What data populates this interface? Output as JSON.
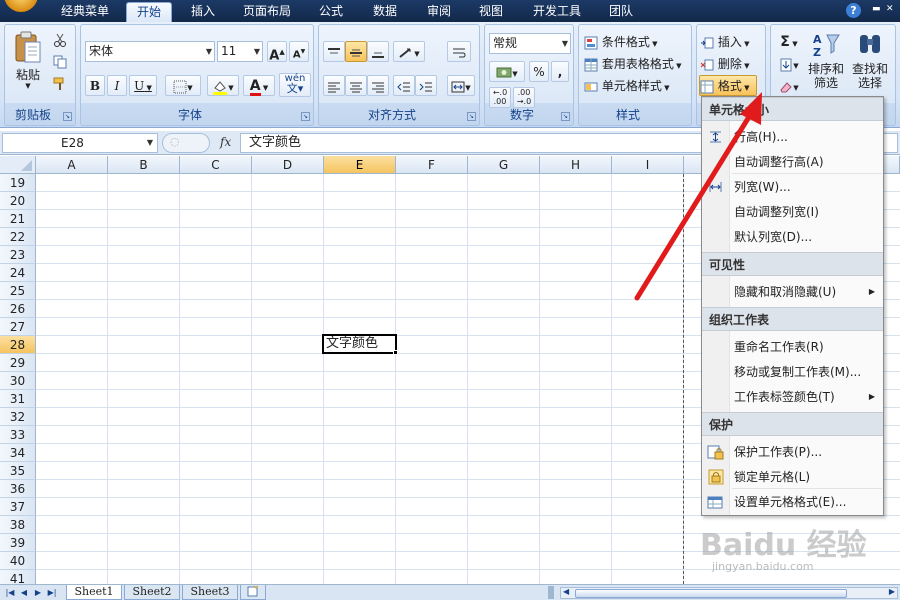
{
  "tabs": [
    {
      "label": "经典菜单"
    },
    {
      "label": "开始"
    },
    {
      "label": "插入"
    },
    {
      "label": "页面布局"
    },
    {
      "label": "公式"
    },
    {
      "label": "数据"
    },
    {
      "label": "审阅"
    },
    {
      "label": "视图"
    },
    {
      "label": "开发工具"
    },
    {
      "label": "团队"
    }
  ],
  "active_tab": "开始",
  "clipboard": {
    "group_label": "剪贴板",
    "paste_label": "粘贴"
  },
  "font": {
    "group_label": "字体",
    "font_name": "宋体",
    "font_size": "11",
    "bold": "B",
    "italic": "I",
    "underline": "U",
    "grow": "A",
    "shrink": "A",
    "font_color_letter": "A",
    "pinyin": "wén"
  },
  "alignment": {
    "group_label": "对齐方式"
  },
  "number": {
    "group_label": "数字",
    "format": "常规",
    "percent": "%",
    "comma": ",",
    "inc_decimal": "+.0\n.00",
    "dec_decimal": ".00\n+.0"
  },
  "styles": {
    "group_label": "样式",
    "conditional_format": "条件格式",
    "table_format": "套用表格格式",
    "cell_styles": "单元格样式"
  },
  "cells": {
    "insert": "插入",
    "delete": "删除",
    "format": "格式"
  },
  "editing": {
    "sigma": "Σ",
    "sort_filter_1": "排序和",
    "sort_filter_2": "筛选",
    "find_select_1": "查找和",
    "find_select_2": "选择"
  },
  "formula_bar": {
    "name_box": "E28",
    "fx": "fx",
    "content": "文字颜色"
  },
  "columns": [
    "A",
    "B",
    "C",
    "D",
    "E",
    "F",
    "G",
    "H",
    "I"
  ],
  "selected_column": "E",
  "rows": [
    "19",
    "20",
    "21",
    "22",
    "23",
    "24",
    "25",
    "26",
    "27",
    "28",
    "29",
    "30",
    "31",
    "32",
    "33",
    "34",
    "35",
    "36",
    "37",
    "38",
    "39",
    "40",
    "41"
  ],
  "selected_row": "28",
  "active_cell": {
    "ref": "E28",
    "value": "文字颜色"
  },
  "sheets": [
    "Sheet1",
    "Sheet2",
    "Sheet3"
  ],
  "active_sheet": "Sheet1",
  "format_menu": {
    "sections": [
      {
        "header": "单元格大小",
        "items": [
          {
            "label": "行高(H)...",
            "icon": "row-height-icon",
            "submenu": false
          },
          {
            "label": "自动调整行高(A)",
            "icon": "",
            "submenu": false
          },
          {
            "label": "列宽(W)...",
            "icon": "column-width-icon",
            "submenu": false
          },
          {
            "label": "自动调整列宽(I)",
            "icon": "",
            "submenu": false
          },
          {
            "label": "默认列宽(D)...",
            "icon": "",
            "submenu": false
          }
        ]
      },
      {
        "header": "可见性",
        "items": [
          {
            "label": "隐藏和取消隐藏(U)",
            "icon": "",
            "submenu": true
          }
        ]
      },
      {
        "header": "组织工作表",
        "items": [
          {
            "label": "重命名工作表(R)",
            "icon": "",
            "submenu": false
          },
          {
            "label": "移动或复制工作表(M)...",
            "icon": "",
            "submenu": false
          },
          {
            "label": "工作表标签颜色(T)",
            "icon": "",
            "submenu": true
          }
        ]
      },
      {
        "header": "保护",
        "items": [
          {
            "label": "保护工作表(P)...",
            "icon": "protect-sheet-icon",
            "submenu": false
          },
          {
            "label": "锁定单元格(L)",
            "icon": "lock-icon",
            "submenu": false
          },
          {
            "label": "设置单元格格式(E)...",
            "icon": "format-cells-icon",
            "submenu": false
          }
        ]
      }
    ]
  },
  "watermark": {
    "text": "Baidu 经验",
    "url": "jingyan.baidu.com"
  },
  "colors": {
    "annotation_arrow": "#e11b1b",
    "ribbon_text": "#15428b",
    "tab_bar": "#1c3a66"
  }
}
